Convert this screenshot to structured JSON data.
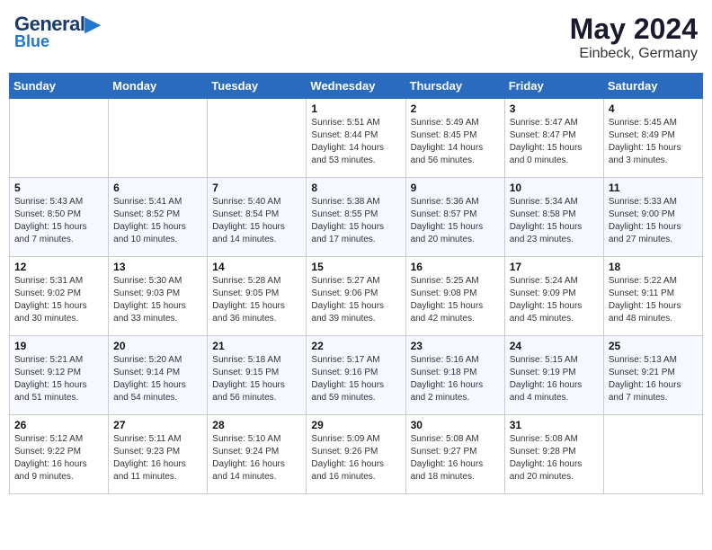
{
  "header": {
    "logo_line1": "General",
    "logo_line2": "Blue",
    "title": "May 2024",
    "subtitle": "Einbeck, Germany"
  },
  "weekdays": [
    "Sunday",
    "Monday",
    "Tuesday",
    "Wednesday",
    "Thursday",
    "Friday",
    "Saturday"
  ],
  "weeks": [
    [
      {
        "day": "",
        "info": ""
      },
      {
        "day": "",
        "info": ""
      },
      {
        "day": "",
        "info": ""
      },
      {
        "day": "1",
        "info": "Sunrise: 5:51 AM\nSunset: 8:44 PM\nDaylight: 14 hours and 53 minutes."
      },
      {
        "day": "2",
        "info": "Sunrise: 5:49 AM\nSunset: 8:45 PM\nDaylight: 14 hours and 56 minutes."
      },
      {
        "day": "3",
        "info": "Sunrise: 5:47 AM\nSunset: 8:47 PM\nDaylight: 15 hours and 0 minutes."
      },
      {
        "day": "4",
        "info": "Sunrise: 5:45 AM\nSunset: 8:49 PM\nDaylight: 15 hours and 3 minutes."
      }
    ],
    [
      {
        "day": "5",
        "info": "Sunrise: 5:43 AM\nSunset: 8:50 PM\nDaylight: 15 hours and 7 minutes."
      },
      {
        "day": "6",
        "info": "Sunrise: 5:41 AM\nSunset: 8:52 PM\nDaylight: 15 hours and 10 minutes."
      },
      {
        "day": "7",
        "info": "Sunrise: 5:40 AM\nSunset: 8:54 PM\nDaylight: 15 hours and 14 minutes."
      },
      {
        "day": "8",
        "info": "Sunrise: 5:38 AM\nSunset: 8:55 PM\nDaylight: 15 hours and 17 minutes."
      },
      {
        "day": "9",
        "info": "Sunrise: 5:36 AM\nSunset: 8:57 PM\nDaylight: 15 hours and 20 minutes."
      },
      {
        "day": "10",
        "info": "Sunrise: 5:34 AM\nSunset: 8:58 PM\nDaylight: 15 hours and 23 minutes."
      },
      {
        "day": "11",
        "info": "Sunrise: 5:33 AM\nSunset: 9:00 PM\nDaylight: 15 hours and 27 minutes."
      }
    ],
    [
      {
        "day": "12",
        "info": "Sunrise: 5:31 AM\nSunset: 9:02 PM\nDaylight: 15 hours and 30 minutes."
      },
      {
        "day": "13",
        "info": "Sunrise: 5:30 AM\nSunset: 9:03 PM\nDaylight: 15 hours and 33 minutes."
      },
      {
        "day": "14",
        "info": "Sunrise: 5:28 AM\nSunset: 9:05 PM\nDaylight: 15 hours and 36 minutes."
      },
      {
        "day": "15",
        "info": "Sunrise: 5:27 AM\nSunset: 9:06 PM\nDaylight: 15 hours and 39 minutes."
      },
      {
        "day": "16",
        "info": "Sunrise: 5:25 AM\nSunset: 9:08 PM\nDaylight: 15 hours and 42 minutes."
      },
      {
        "day": "17",
        "info": "Sunrise: 5:24 AM\nSunset: 9:09 PM\nDaylight: 15 hours and 45 minutes."
      },
      {
        "day": "18",
        "info": "Sunrise: 5:22 AM\nSunset: 9:11 PM\nDaylight: 15 hours and 48 minutes."
      }
    ],
    [
      {
        "day": "19",
        "info": "Sunrise: 5:21 AM\nSunset: 9:12 PM\nDaylight: 15 hours and 51 minutes."
      },
      {
        "day": "20",
        "info": "Sunrise: 5:20 AM\nSunset: 9:14 PM\nDaylight: 15 hours and 54 minutes."
      },
      {
        "day": "21",
        "info": "Sunrise: 5:18 AM\nSunset: 9:15 PM\nDaylight: 15 hours and 56 minutes."
      },
      {
        "day": "22",
        "info": "Sunrise: 5:17 AM\nSunset: 9:16 PM\nDaylight: 15 hours and 59 minutes."
      },
      {
        "day": "23",
        "info": "Sunrise: 5:16 AM\nSunset: 9:18 PM\nDaylight: 16 hours and 2 minutes."
      },
      {
        "day": "24",
        "info": "Sunrise: 5:15 AM\nSunset: 9:19 PM\nDaylight: 16 hours and 4 minutes."
      },
      {
        "day": "25",
        "info": "Sunrise: 5:13 AM\nSunset: 9:21 PM\nDaylight: 16 hours and 7 minutes."
      }
    ],
    [
      {
        "day": "26",
        "info": "Sunrise: 5:12 AM\nSunset: 9:22 PM\nDaylight: 16 hours and 9 minutes."
      },
      {
        "day": "27",
        "info": "Sunrise: 5:11 AM\nSunset: 9:23 PM\nDaylight: 16 hours and 11 minutes."
      },
      {
        "day": "28",
        "info": "Sunrise: 5:10 AM\nSunset: 9:24 PM\nDaylight: 16 hours and 14 minutes."
      },
      {
        "day": "29",
        "info": "Sunrise: 5:09 AM\nSunset: 9:26 PM\nDaylight: 16 hours and 16 minutes."
      },
      {
        "day": "30",
        "info": "Sunrise: 5:08 AM\nSunset: 9:27 PM\nDaylight: 16 hours and 18 minutes."
      },
      {
        "day": "31",
        "info": "Sunrise: 5:08 AM\nSunset: 9:28 PM\nDaylight: 16 hours and 20 minutes."
      },
      {
        "day": "",
        "info": ""
      }
    ]
  ]
}
